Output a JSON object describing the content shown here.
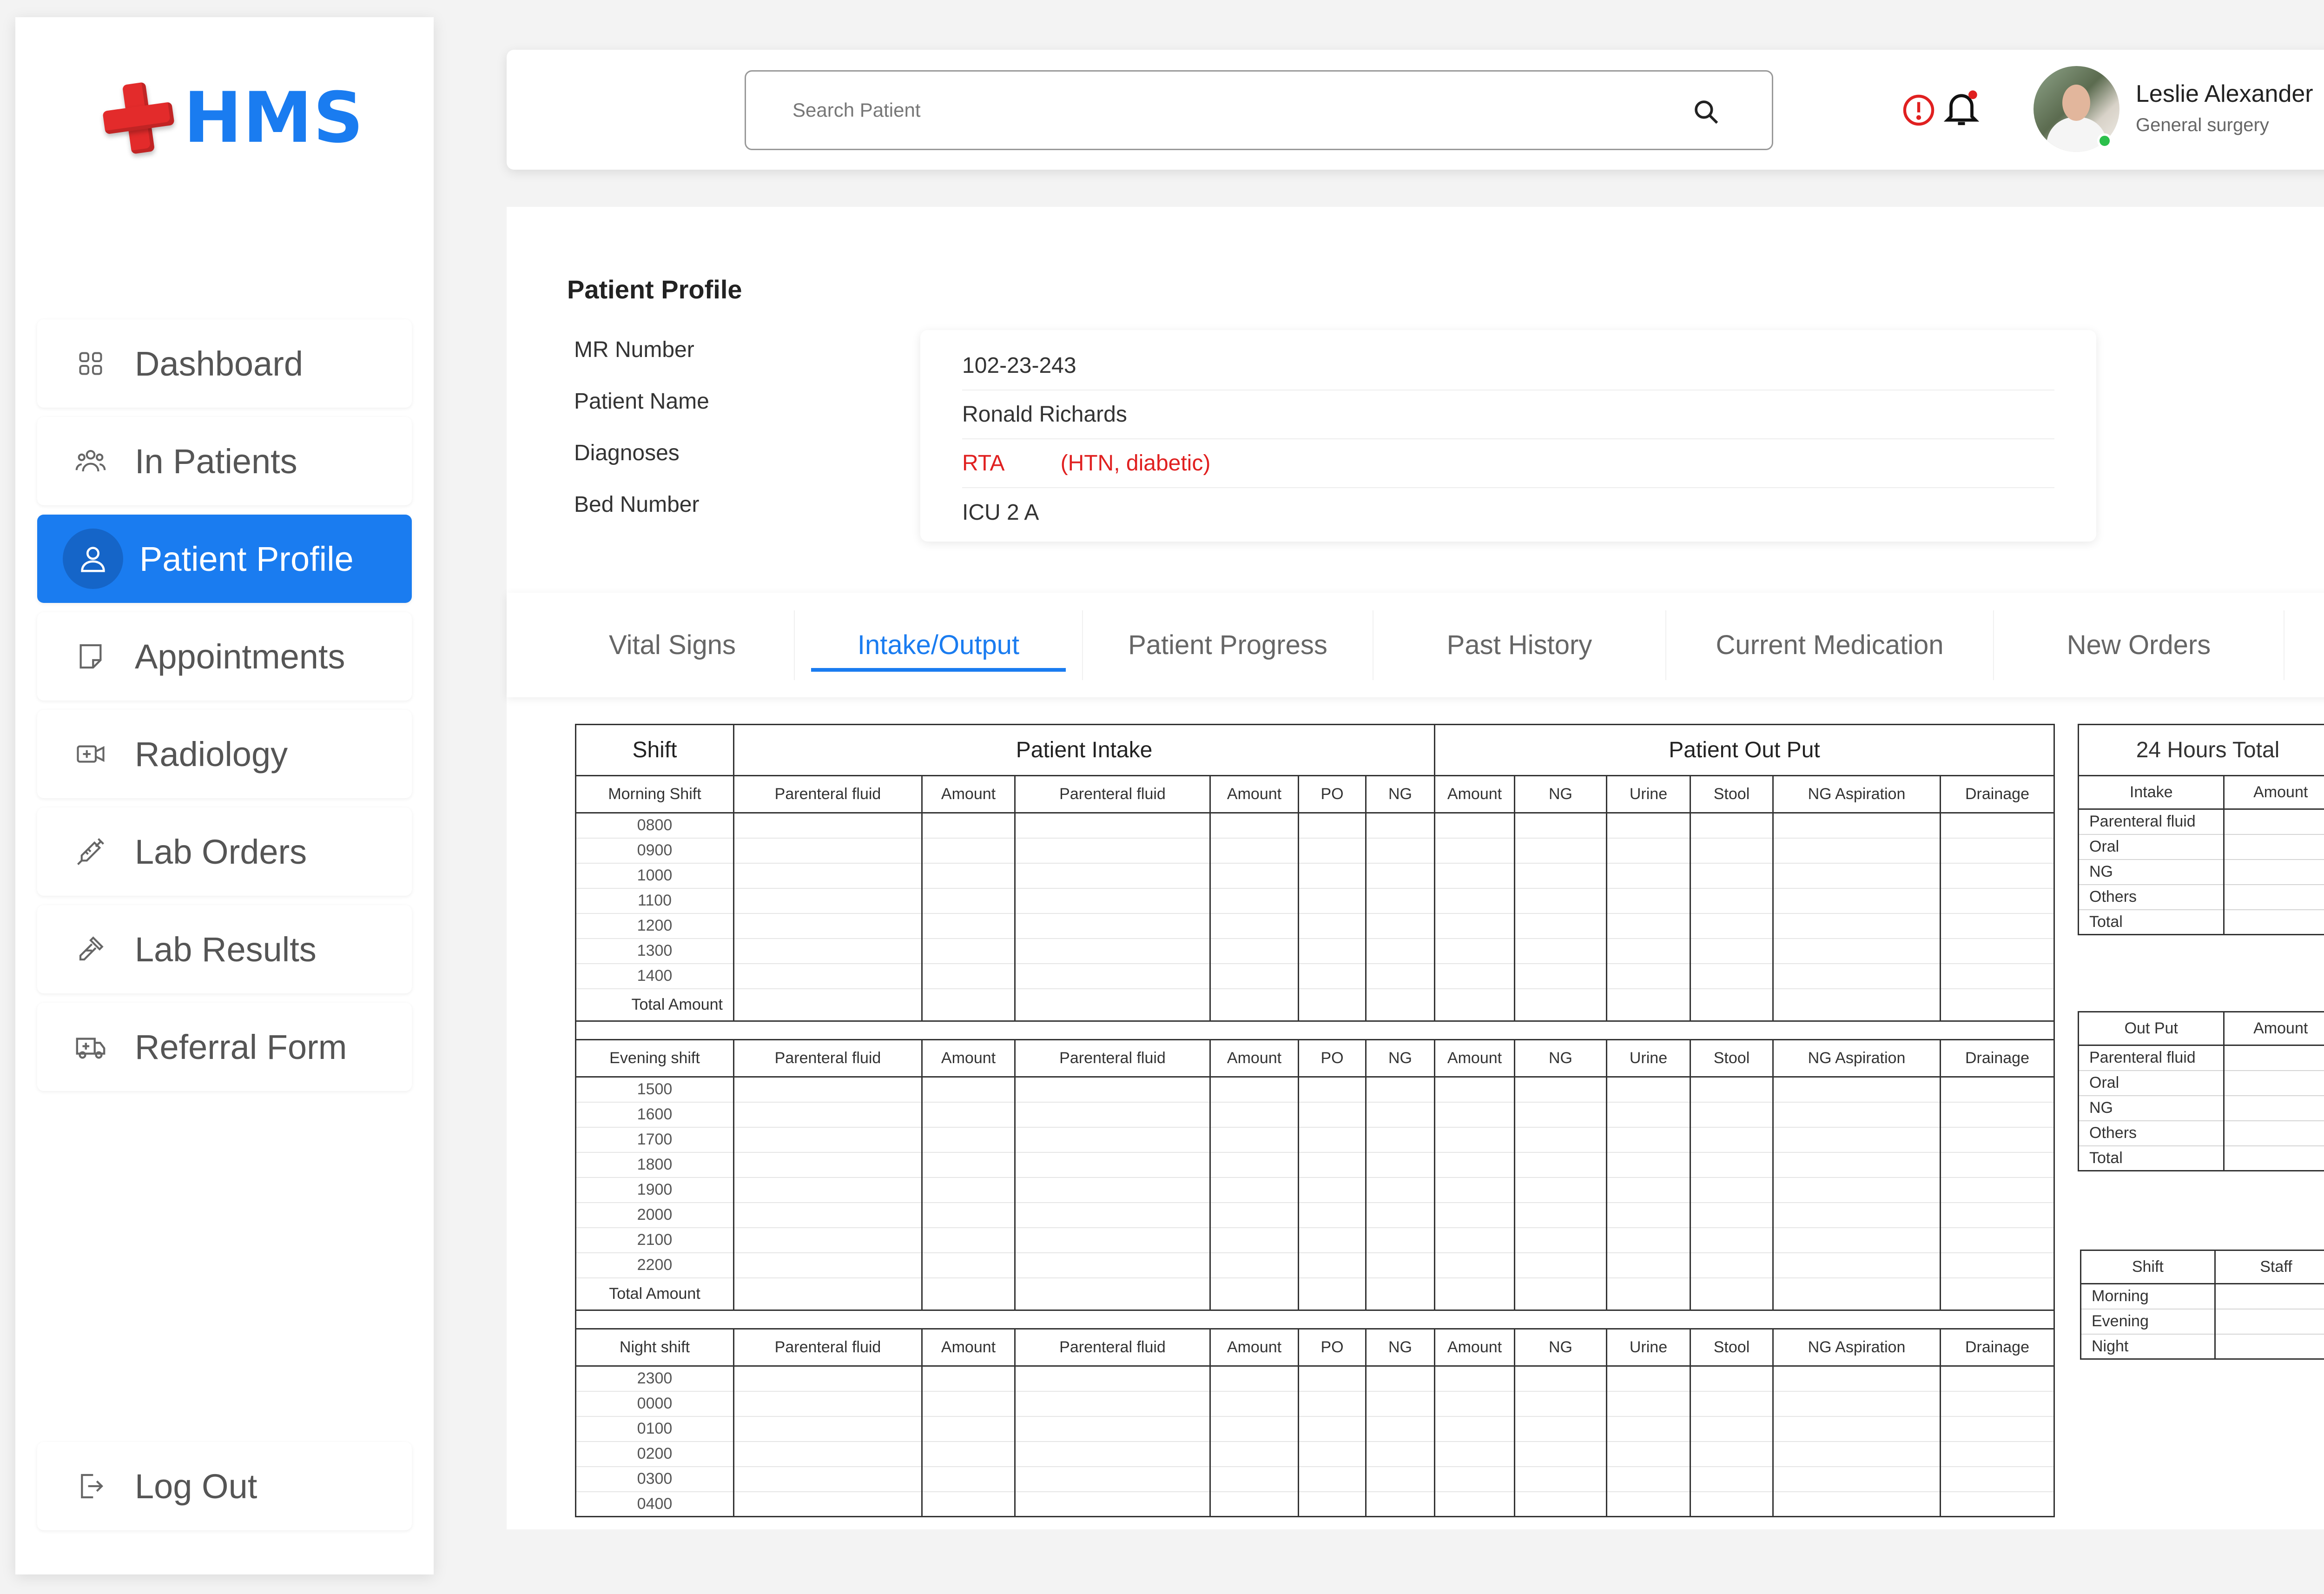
{
  "app": {
    "logo_text": "HMS",
    "accent": "#1a7cf0",
    "logo_color": "#e32b2b"
  },
  "sidebar": {
    "items": [
      {
        "label": "Dashboard",
        "icon": "grid-icon"
      },
      {
        "label": "In Patients",
        "icon": "users-icon"
      },
      {
        "label": "Patient Profile",
        "icon": "user-icon",
        "active": true
      },
      {
        "label": "Appointments",
        "icon": "note-icon"
      },
      {
        "label": "Radiology",
        "icon": "video-plus-icon"
      },
      {
        "label": "Lab Orders",
        "icon": "syringe-icon"
      },
      {
        "label": "Lab Results",
        "icon": "pipette-icon"
      },
      {
        "label": "Referral Form",
        "icon": "ambulance-icon"
      }
    ],
    "logout": "Log Out"
  },
  "header": {
    "search_placeholder": "Search Patient",
    "user_name": "Leslie Alexander",
    "user_role": "General surgery"
  },
  "profile": {
    "title": "Patient Profile",
    "labels": [
      "MR  Number",
      "Patient Name",
      "Diagnoses",
      "Bed Number"
    ],
    "mr_number": "102-23-243",
    "patient_name": "Ronald Richards",
    "diagnosis": "RTA",
    "diagnosis_extra": "(HTN, diabetic)",
    "bed_number": "ICU 2 A"
  },
  "tabs": [
    "Vital Signs",
    "Intake/Output",
    "Patient Progress",
    "Past History",
    "Current Medication",
    "New Orders"
  ],
  "io_table": {
    "group_headers": [
      "Shift",
      "Patient Intake",
      "Patient Out Put"
    ],
    "columns": [
      "Parenteral fluid",
      "Amount",
      "Parenteral fluid",
      "Amount",
      "PO",
      "NG",
      "Amount",
      "NG",
      "Urine",
      "Stool",
      "NG Aspiration",
      "Drainage"
    ],
    "total_label": "Total Amount",
    "shifts": [
      {
        "name": "Morning Shift",
        "times": [
          "0800",
          "0900",
          "1000",
          "1100",
          "1200",
          "1300",
          "1400"
        ]
      },
      {
        "name": "Evening shift",
        "times": [
          "1500",
          "1600",
          "1700",
          "1800",
          "1900",
          "2000",
          "2100",
          "2200"
        ]
      },
      {
        "name": "Night shift",
        "times": [
          "2300",
          "0000",
          "0100",
          "0200",
          "0300",
          "0400"
        ]
      }
    ]
  },
  "totals": {
    "title": "24 Hours Total",
    "intake_headers": [
      "Intake",
      "Amount"
    ],
    "intake_rows": [
      "Parenteral fluid",
      "Oral",
      "NG",
      "Others",
      "Total"
    ],
    "output_headers": [
      "Out Put",
      "Amount"
    ],
    "output_rows": [
      "Parenteral fluid",
      "Oral",
      "NG",
      "Others",
      "Total"
    ],
    "staff_headers": [
      "Shift",
      "Staff"
    ],
    "staff_rows": [
      "Morning",
      "Evening",
      "Night"
    ]
  }
}
